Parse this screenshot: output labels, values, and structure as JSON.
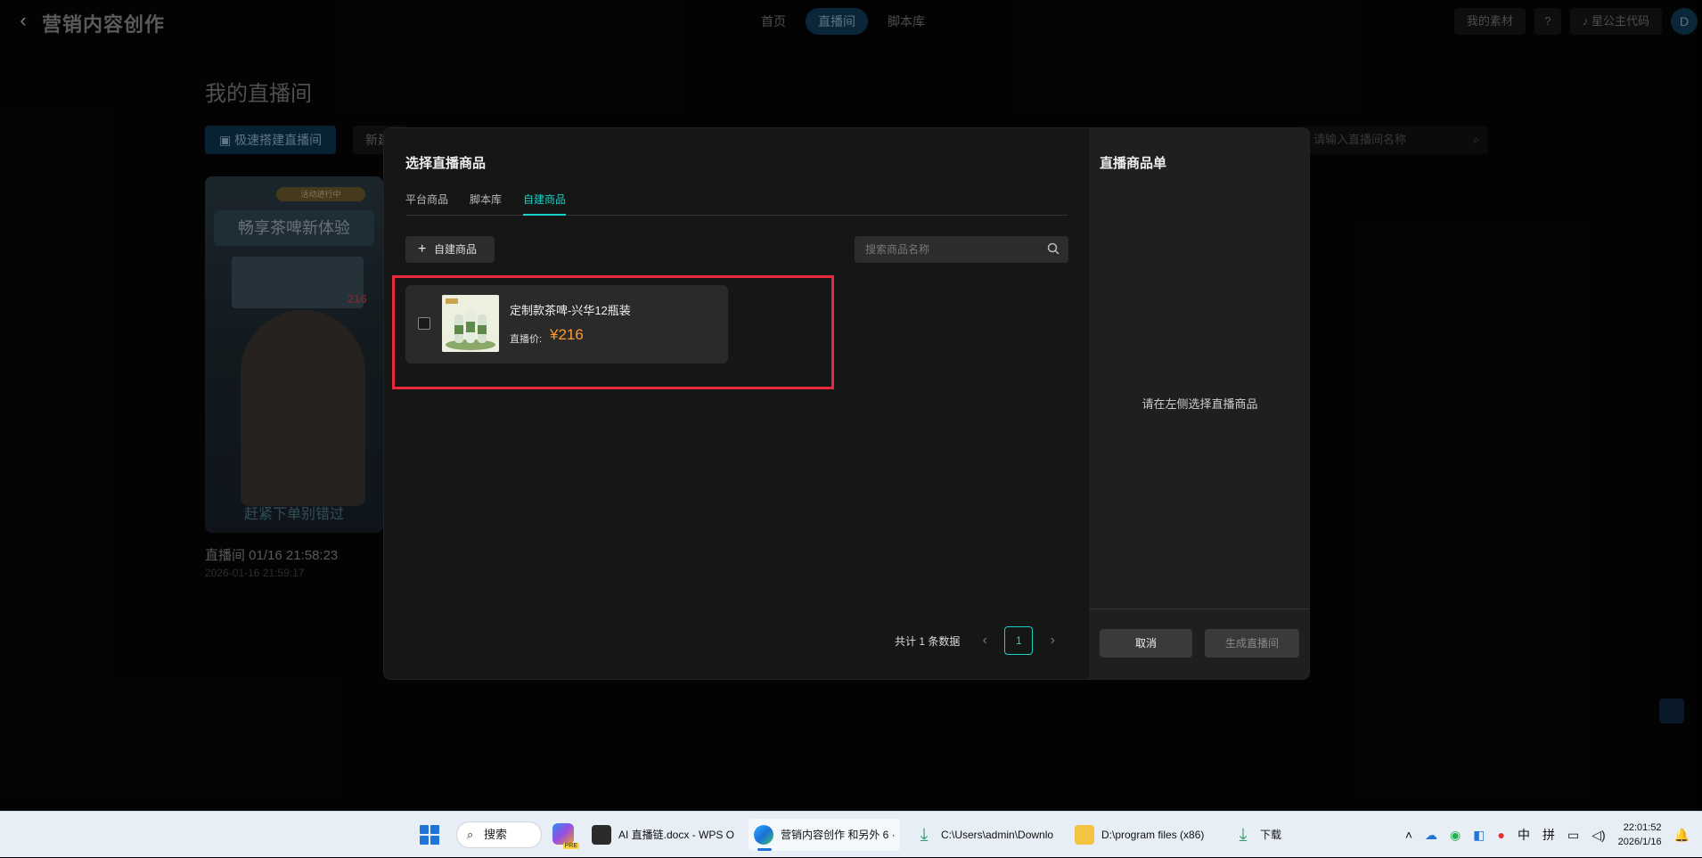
{
  "header": {
    "back_icon": "chevron-left-icon",
    "app_title": "营销内容创作",
    "nav": [
      "首页",
      "直播间",
      "脚本库"
    ],
    "nav_active": "直播间",
    "my_materials": "我的素材",
    "help_icon": "question-icon",
    "douyin_code": "星公主代码",
    "avatar_letter": "D"
  },
  "background_page": {
    "title": "我的直播间",
    "quick_build": "极速搭建直播间",
    "new_button": "新建",
    "search_placeholder": "请输入直播间名称",
    "card": {
      "ribbon": "活动进行中",
      "banner": "畅享茶啤新体验",
      "badge_price": "216",
      "bottom_text": "赶紧下单别错过",
      "title": "直播间 01/16 21:58:23",
      "date": "2026-01-16 21:59:17"
    }
  },
  "modal": {
    "title": "选择直播商品",
    "tabs": [
      "平台商品",
      "脚本库",
      "自建商品"
    ],
    "active_tab": "自建商品",
    "create_button": "自建商品",
    "search_placeholder": "搜索商品名称",
    "products": [
      {
        "name": "定制款茶啤-兴华12瓶装",
        "price_label": "直播价:",
        "price": "¥216",
        "checked": false
      }
    ],
    "pagination": {
      "total_text": "共计 1 条数据",
      "current_page": "1",
      "prev_icon": "chevron-left-icon",
      "next_icon": "chevron-right-icon"
    },
    "right_panel": {
      "title": "直播商品单",
      "empty_text": "请在左侧选择直播商品",
      "cancel": "取消",
      "generate": "生成直播间"
    }
  },
  "taskbar": {
    "search_label": "搜索",
    "apps": [
      {
        "label": "AI 直播链.docx - WPS O",
        "icon": "wps-icon"
      },
      {
        "label": "营销内容创作 和另外 6 ·",
        "icon": "edge-icon",
        "active": true
      },
      {
        "label": "C:\\Users\\admin\\Downlo",
        "icon": "download-icon"
      },
      {
        "label": "D:\\program files (x86)",
        "icon": "folder-icon"
      },
      {
        "label": "下载",
        "icon": "download-icon"
      }
    ],
    "ime_lang": "中",
    "ime_mode": "拼",
    "time": "22:01:52",
    "date": "2026/1/16"
  },
  "colors": {
    "accent": "#19d1c4",
    "price": "#ff9a2e",
    "highlight": "#e8283c"
  }
}
